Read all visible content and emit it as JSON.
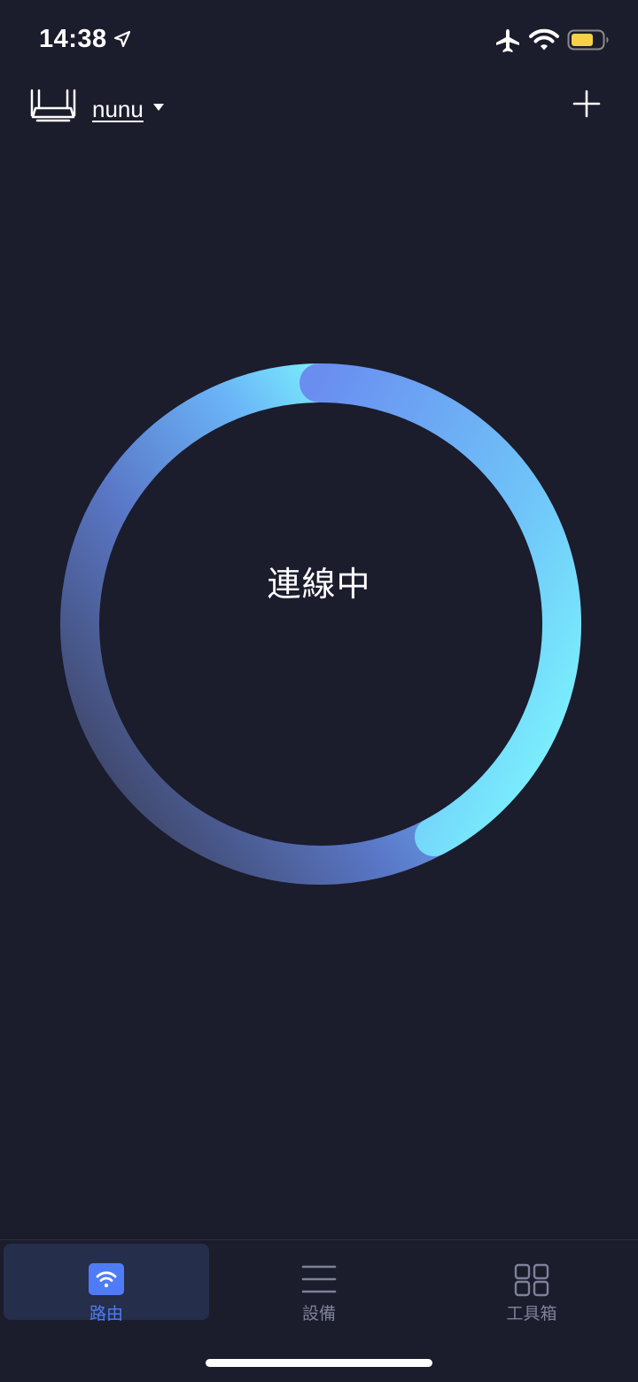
{
  "status_bar": {
    "time": "14:38",
    "icons": [
      "location-arrow-icon",
      "airplane-icon",
      "wifi-icon",
      "battery-icon"
    ],
    "battery_color": "#f5d04a"
  },
  "header": {
    "device_icon": "router-icon",
    "router_name": "nunu",
    "dropdown_icon": "caret-down-icon",
    "add_icon": "plus-icon"
  },
  "main": {
    "status_text": "連線中",
    "progress_ring": {
      "gradient_start": "#3f4663",
      "gradient_mid": "#6a94ef",
      "gradient_end": "#7efdff"
    }
  },
  "tabbar": {
    "accent_color": "#4f7cf6",
    "tabs": [
      {
        "label": "路由",
        "icon": "wifi-box-icon",
        "active": true
      },
      {
        "label": "設備",
        "icon": "list-icon",
        "active": false
      },
      {
        "label": "工具箱",
        "icon": "grid-icon",
        "active": false
      }
    ]
  }
}
